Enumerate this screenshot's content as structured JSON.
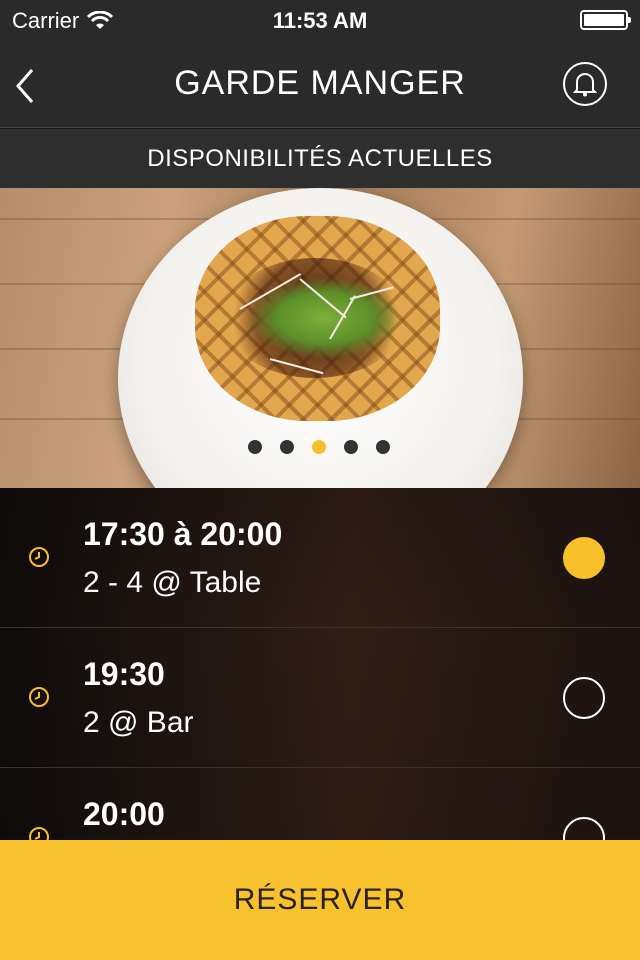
{
  "status_bar": {
    "carrier": "Carrier",
    "time": "11:53 AM"
  },
  "nav": {
    "title": "GARDE MANGER",
    "back_icon": "chevron-left-icon",
    "bell_icon": "bell-icon"
  },
  "subheader": {
    "label": "DISPONIBILITÉS ACTUELLES"
  },
  "hero": {
    "page_count": 5,
    "active_page": 3
  },
  "availability": [
    {
      "time": "17:30 à 20:00",
      "detail": "2 - 4 @ Table",
      "selected": true
    },
    {
      "time": "19:30",
      "detail": "2 @ Bar",
      "selected": false
    },
    {
      "time": "20:00",
      "detail": "",
      "selected": false
    }
  ],
  "reserve_button": {
    "label": "RÉSERVER"
  },
  "colors": {
    "accent": "#f7c02b",
    "bar": "#2a2a2a",
    "button": "#f8c22f"
  }
}
